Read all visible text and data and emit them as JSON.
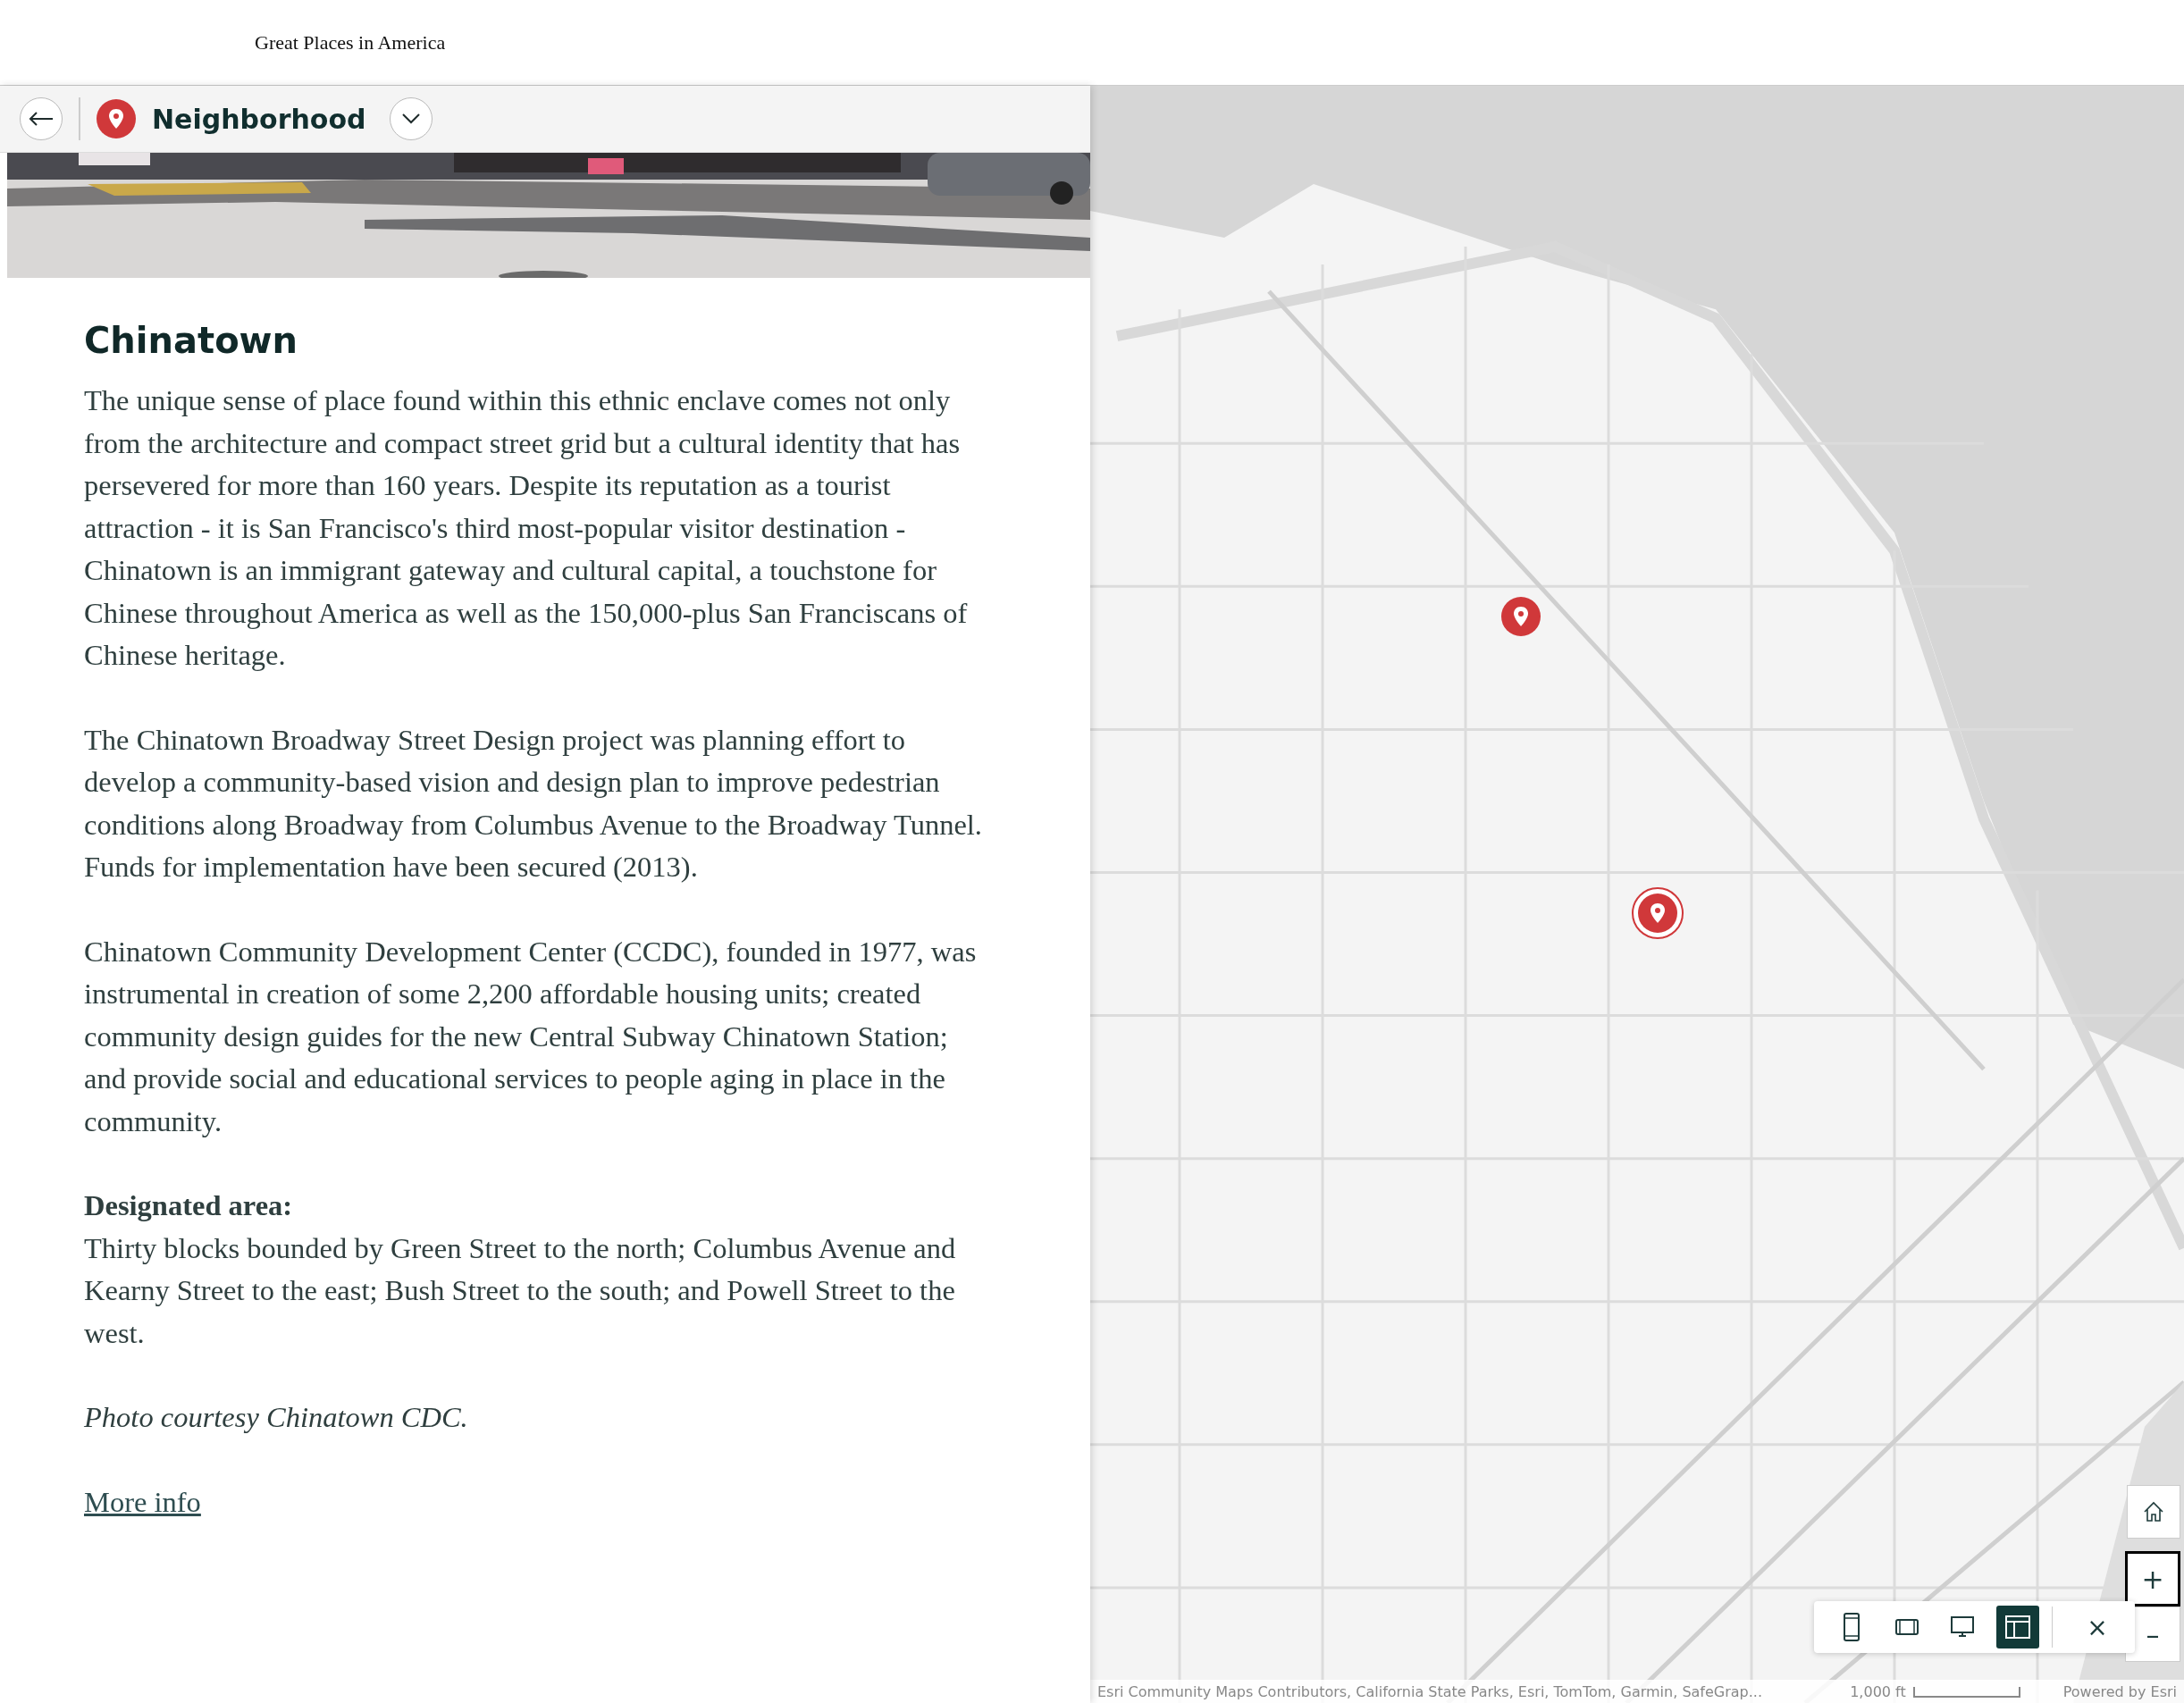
{
  "header": {
    "title": "Great Places in America"
  },
  "nav": {
    "title": "Neighborhood"
  },
  "story": {
    "photo": {
      "kind": "picture"
    },
    "heading": "Chinatown",
    "paragraphs": [
      "The unique sense of place found within this ethnic enclave comes not only from the architecture and compact street grid but a cultural identity that has persevered for more than 160 years. Despite its reputation as a tourist attraction - it is San Francisco's third most-popular visitor destination - Chinatown is an immigrant gateway and cultural capital, a touchstone for Chinese throughout America as well as the 150,000-plus San Franciscans of Chinese heritage.",
      "The Chinatown Broadway Street Design project was planning effort to develop a community-based vision and design plan to improve pedestrian conditions along Broadway from Columbus Avenue to the Broadway Tunnel. Funds for implementation have been secured (2013).",
      "Chinatown Community Development Center (CCDC), founded in 1977, was instrumental in creation of some 2,200 affordable housing units; created community design guides for the new Central Subway Chinatown Station; and provide social and educational services to people aging in place in the community."
    ],
    "designated": {
      "label": "Designated area:",
      "text": "Thirty blocks bounded by Green Street to the north; Columbus Avenue and Kearny Street to the east; Bush Street to the south; and Powell Street to the west."
    },
    "credit": "Photo courtesy Chinatown CDC.",
    "link": "More info"
  },
  "map": {
    "kind": "picture",
    "markers": [
      {
        "selected": false
      },
      {
        "selected": true
      }
    ],
    "zoom_in": "+",
    "zoom_out": "–",
    "device_buttons": [
      {
        "kind": "phone",
        "selected": false
      },
      {
        "kind": "tablet",
        "selected": false
      },
      {
        "kind": "desktop",
        "selected": false
      },
      {
        "kind": "layout",
        "selected": true
      }
    ],
    "close": "×",
    "attribution": "Esri Community Maps Contributors, California State Parks, Esri, TomTom, Garmin, SafeGrap...",
    "scale": "1,000 ft",
    "powered_by": "Powered by Esri"
  }
}
